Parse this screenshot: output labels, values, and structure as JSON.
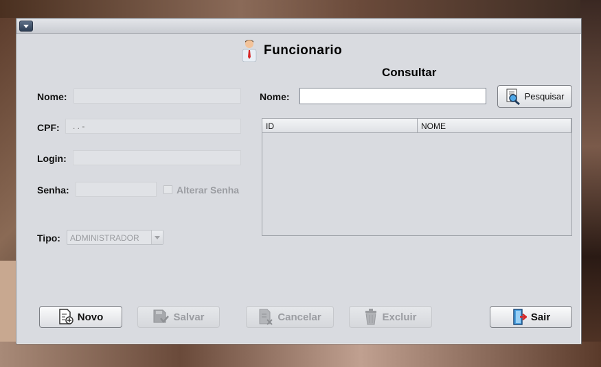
{
  "window": {
    "title": "Funcionario"
  },
  "form": {
    "nome_label": "Nome:",
    "nome_value": "",
    "cpf_label": "CPF:",
    "cpf_value": ". . -",
    "login_label": "Login:",
    "login_value": "",
    "senha_label": "Senha:",
    "senha_value": "",
    "alterar_senha_label": "Alterar Senha",
    "alterar_senha_checked": false,
    "tipo_label": "Tipo:",
    "tipo_value": "ADMINISTRADOR"
  },
  "consultar": {
    "heading": "Consultar",
    "nome_label": "Nome:",
    "search_value": "",
    "pesquisar_label": "Pesquisar",
    "columns": [
      "ID",
      "NOME"
    ],
    "rows": []
  },
  "actions": {
    "novo": "Novo",
    "salvar": "Salvar",
    "cancelar": "Cancelar",
    "excluir": "Excluir",
    "sair": "Sair"
  },
  "colors": {
    "window_bg": "#d9dbe0",
    "disabled_text": "#9b9da2",
    "tie_red": "#d62828"
  },
  "icons": {
    "menu": "dropdown-menu-icon",
    "title": "employee-icon",
    "pesquisar": "search-document-icon",
    "novo": "new-document-icon",
    "salvar": "save-icon",
    "cancelar": "cancel-document-icon",
    "excluir": "trash-icon",
    "sair": "exit-door-icon"
  }
}
